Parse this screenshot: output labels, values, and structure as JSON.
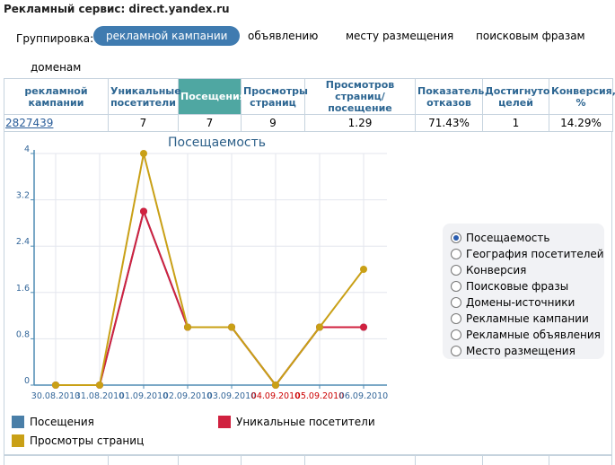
{
  "page": {
    "title": "Рекламный сервис: direct.yandex.ru"
  },
  "grouping": {
    "label": "Группировка:",
    "options": [
      {
        "label": "рекламной кампании",
        "active": true
      },
      {
        "label": "объявлению",
        "active": false
      },
      {
        "label": "месту размещения",
        "active": false
      },
      {
        "label": "поисковым фразам",
        "active": false
      },
      {
        "label": "доменам",
        "active": false
      }
    ]
  },
  "table": {
    "headers": [
      "рекламной кампании",
      "Уникальные посетители",
      "Посещения",
      "Просмотры страниц",
      "Просмотров страниц/посещение",
      "Показатель отказов",
      "Достигнуто целей",
      "Конверсия, %"
    ],
    "active_header_index": 2,
    "rows": [
      [
        "2827439",
        "7",
        "7",
        "9",
        "1.29",
        "71.43%",
        "1",
        "14.29%"
      ]
    ]
  },
  "chart_data": {
    "type": "line",
    "title": "Посещаемость",
    "categories": [
      "30.08.2010",
      "31.08.2010",
      "01.09.2010",
      "02.09.2010",
      "03.09.2010",
      "04.09.2010",
      "05.09.2010",
      "06.09.2010"
    ],
    "category_colors": [
      "#336699",
      "#336699",
      "#336699",
      "#336699",
      "#336699",
      "#cc0000",
      "#cc0000",
      "#336699"
    ],
    "yticks": [
      "0",
      "0.8",
      "1.6",
      "2.4",
      "3.2",
      "4"
    ],
    "ylim": [
      0,
      4
    ],
    "series": [
      {
        "name": "Посещения",
        "color": "#4a7fa8",
        "values": [
          0,
          0,
          3,
          1,
          1,
          0,
          1,
          1
        ]
      },
      {
        "name": "Уникальные посетители",
        "color": "#d0213f",
        "values": [
          0,
          0,
          3,
          1,
          1,
          0,
          1,
          1
        ]
      },
      {
        "name": "Просмотры страниц",
        "color": "#c9a016",
        "values": [
          0,
          0,
          4,
          1,
          1,
          0,
          1,
          2
        ]
      }
    ],
    "grid": true
  },
  "chart_options": {
    "selected_index": 0,
    "items": [
      "Посещаемость",
      "География посетителей",
      "Конверсия",
      "Поисковые фразы",
      "Домены-источники",
      "Рекламные кампании",
      "Рекламные объявления",
      "Место размещения"
    ]
  }
}
